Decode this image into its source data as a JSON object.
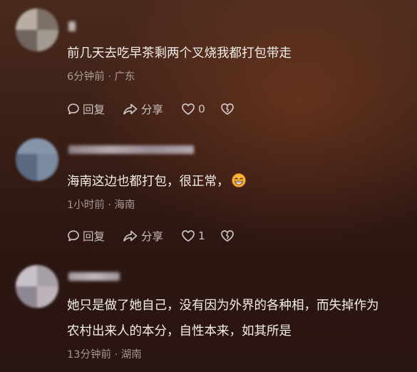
{
  "comments": [
    {
      "text": "前几天去吃早茶剩两个叉烧我都打包带走",
      "meta": "6分钟前 · 广东",
      "reply_label": "回复",
      "share_label": "分享",
      "like_count": "0"
    },
    {
      "text": "海南这边也都打包，很正常，",
      "emoji": "grinning-face-icon",
      "meta": "1小时前 · 海南",
      "reply_label": "回复",
      "share_label": "分享",
      "like_count": "1"
    },
    {
      "text_line1": "她只是做了她自己，没有因为外界的各种相，而失掉作为",
      "text_line2": "农村出来人的本分，自性本来，如其所是",
      "meta": "13分钟前 · 湖南"
    }
  ],
  "colors": {
    "background_top": "#4a2a1d",
    "background_bottom": "#281411",
    "text": "#f4eeea",
    "meta": "#a89590",
    "emoji_face": "#f6b73c"
  }
}
